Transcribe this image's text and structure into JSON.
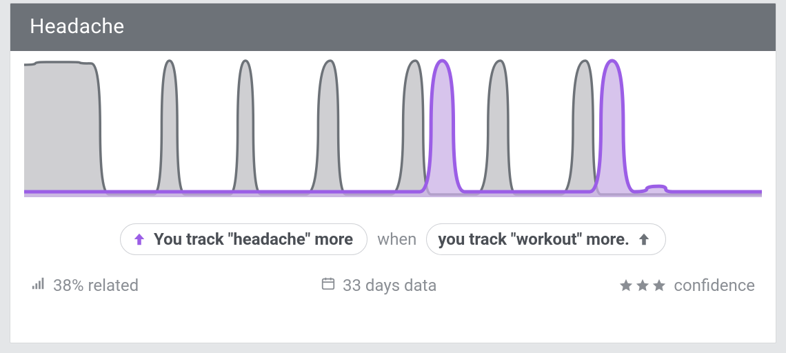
{
  "header": {
    "title": "Headache"
  },
  "insight": {
    "left_pill": "You track \"headache\" more",
    "connector": "when",
    "right_pill": "you track \"workout\" more."
  },
  "stats": {
    "related": "38% related",
    "days": "33 days data",
    "confidence_label": "confidence",
    "confidence_stars": 3
  },
  "colors": {
    "accent": "#9b5ee6",
    "accent_fill": "#c9b0e6",
    "series_gray_stroke": "#6d7278",
    "series_gray_fill": "#cfcfd2",
    "muted_text": "#8a8e94"
  },
  "chart_data": {
    "type": "area",
    "title": "",
    "xlabel": "",
    "ylabel": "",
    "ylim": [
      0,
      1
    ],
    "xlim": [
      0,
      33
    ],
    "series": [
      {
        "name": "workout",
        "color": "#6d7278",
        "x": [
          0,
          1,
          2,
          3,
          3.8,
          4.8,
          5.8,
          6.5,
          7.2,
          8.2,
          9.2,
          9.9,
          10.6,
          11.6,
          12.6,
          13.7,
          14.4,
          15.4,
          16.4,
          17.5,
          18.2,
          19.2,
          20.2,
          21.3,
          22.0,
          23.0,
          24.0,
          25.1,
          25.8,
          26.8,
          27.8,
          29.0,
          33.0
        ],
        "values": [
          0.97,
          0.99,
          0.99,
          0.98,
          0.02,
          0.02,
          0.02,
          1.0,
          0.02,
          0.02,
          0.02,
          1.0,
          0.02,
          0.02,
          0.02,
          1.0,
          0.02,
          0.02,
          0.02,
          1.0,
          0.02,
          0.02,
          0.02,
          1.0,
          0.02,
          0.02,
          0.02,
          1.0,
          0.02,
          0.02,
          0.02,
          0.02,
          0.02
        ]
      },
      {
        "name": "headache",
        "color": "#9b5ee6",
        "x": [
          0,
          17.0,
          17.7,
          18.7,
          19.7,
          24.6,
          25.3,
          26.3,
          27.3,
          28.4,
          29.0,
          33.0
        ],
        "values": [
          0.04,
          0.04,
          0.04,
          1.0,
          0.04,
          0.04,
          0.04,
          1.0,
          0.04,
          0.08,
          0.04,
          0.04
        ]
      }
    ]
  }
}
